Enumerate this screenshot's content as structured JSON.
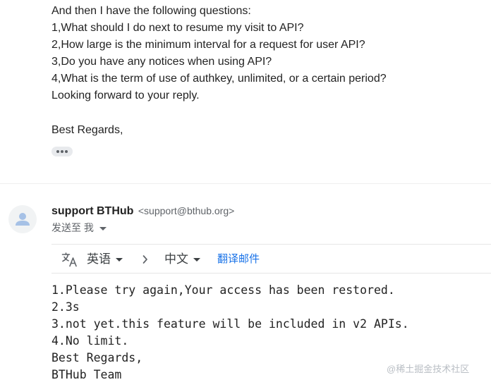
{
  "previous_message": {
    "lines": [
      "And then I have the following questions:",
      "1,What should I do next to resume my visit to API?",
      "2,How large is the minimum interval for a request for user API?",
      "3,Do you have any notices when using API?",
      "4,What is the term of use of authkey, unlimited, or a certain period?",
      "Looking forward to your reply."
    ],
    "regards": "Best Regards,"
  },
  "reply": {
    "sender_name": "support BTHub",
    "sender_email": "<support@bthub.org>",
    "recipient_text": "发送至 我",
    "translate_bar": {
      "source_language": "英语",
      "target_language": "中文",
      "translate_link": "翻译邮件"
    },
    "body_lines": [
      "1.Please try again,Your access has been restored.",
      "2.3s",
      "3.not yet.this feature will be included in v2 APIs.",
      "4.No limit.",
      "Best Regards,",
      "BTHub Team"
    ]
  },
  "watermark": "@稀土掘金技术社区",
  "colors": {
    "link": "#1a73e8",
    "text": "#222222",
    "secondary_text": "#5f6368",
    "avatar_bg": "#f1f3f4",
    "avatar_fg": "#a6c1e6"
  }
}
